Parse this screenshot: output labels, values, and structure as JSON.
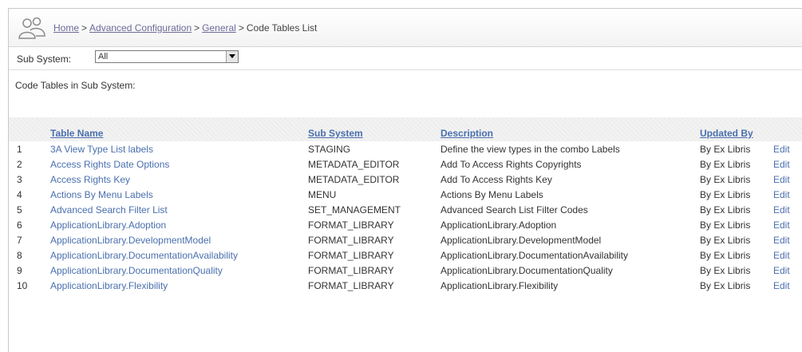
{
  "breadcrumb": {
    "home": "Home",
    "sep": ">",
    "advanced": "Advanced Configuration",
    "general": "General",
    "current": "Code Tables List"
  },
  "filter": {
    "label": "Sub System:",
    "selected": "All"
  },
  "section_label": "Code Tables in Sub System:",
  "table": {
    "headers": {
      "name": "Table Name",
      "subsystem": "Sub System",
      "description": "Description",
      "updated_by": "Updated By"
    },
    "rows": [
      {
        "num": "1",
        "name": "3A View Type List labels",
        "subsystem": "STAGING",
        "description": "Define the view types in the combo Labels",
        "updated_by": "By Ex Libris",
        "action": "Edit"
      },
      {
        "num": "2",
        "name": "Access Rights Date Options",
        "subsystem": "METADATA_EDITOR",
        "description": "Add To Access Rights Copyrights",
        "updated_by": "By Ex Libris",
        "action": "Edit"
      },
      {
        "num": "3",
        "name": "Access Rights Key",
        "subsystem": "METADATA_EDITOR",
        "description": "Add To Access Rights Key",
        "updated_by": "By Ex Libris",
        "action": "Edit"
      },
      {
        "num": "4",
        "name": "Actions By Menu Labels",
        "subsystem": "MENU",
        "description": "Actions By Menu Labels",
        "updated_by": "By Ex Libris",
        "action": "Edit"
      },
      {
        "num": "5",
        "name": "Advanced Search Filter List",
        "subsystem": "SET_MANAGEMENT",
        "description": "Advanced Search List Filter Codes",
        "updated_by": "By Ex Libris",
        "action": "Edit"
      },
      {
        "num": "6",
        "name": "ApplicationLibrary.Adoption",
        "subsystem": "FORMAT_LIBRARY",
        "description": "ApplicationLibrary.Adoption",
        "updated_by": "By Ex Libris",
        "action": "Edit"
      },
      {
        "num": "7",
        "name": "ApplicationLibrary.DevelopmentModel",
        "subsystem": "FORMAT_LIBRARY",
        "description": "ApplicationLibrary.DevelopmentModel",
        "updated_by": "By Ex Libris",
        "action": "Edit"
      },
      {
        "num": "8",
        "name": "ApplicationLibrary.DocumentationAvailability",
        "subsystem": "FORMAT_LIBRARY",
        "description": "ApplicationLibrary.DocumentationAvailability",
        "updated_by": "By Ex Libris",
        "action": "Edit"
      },
      {
        "num": "9",
        "name": "ApplicationLibrary.DocumentationQuality",
        "subsystem": "FORMAT_LIBRARY",
        "description": "ApplicationLibrary.DocumentationQuality",
        "updated_by": "By Ex Libris",
        "action": "Edit"
      },
      {
        "num": "10",
        "name": "ApplicationLibrary.Flexibility",
        "subsystem": "FORMAT_LIBRARY",
        "description": "ApplicationLibrary.Flexibility",
        "updated_by": "By Ex Libris",
        "action": "Edit"
      }
    ]
  }
}
